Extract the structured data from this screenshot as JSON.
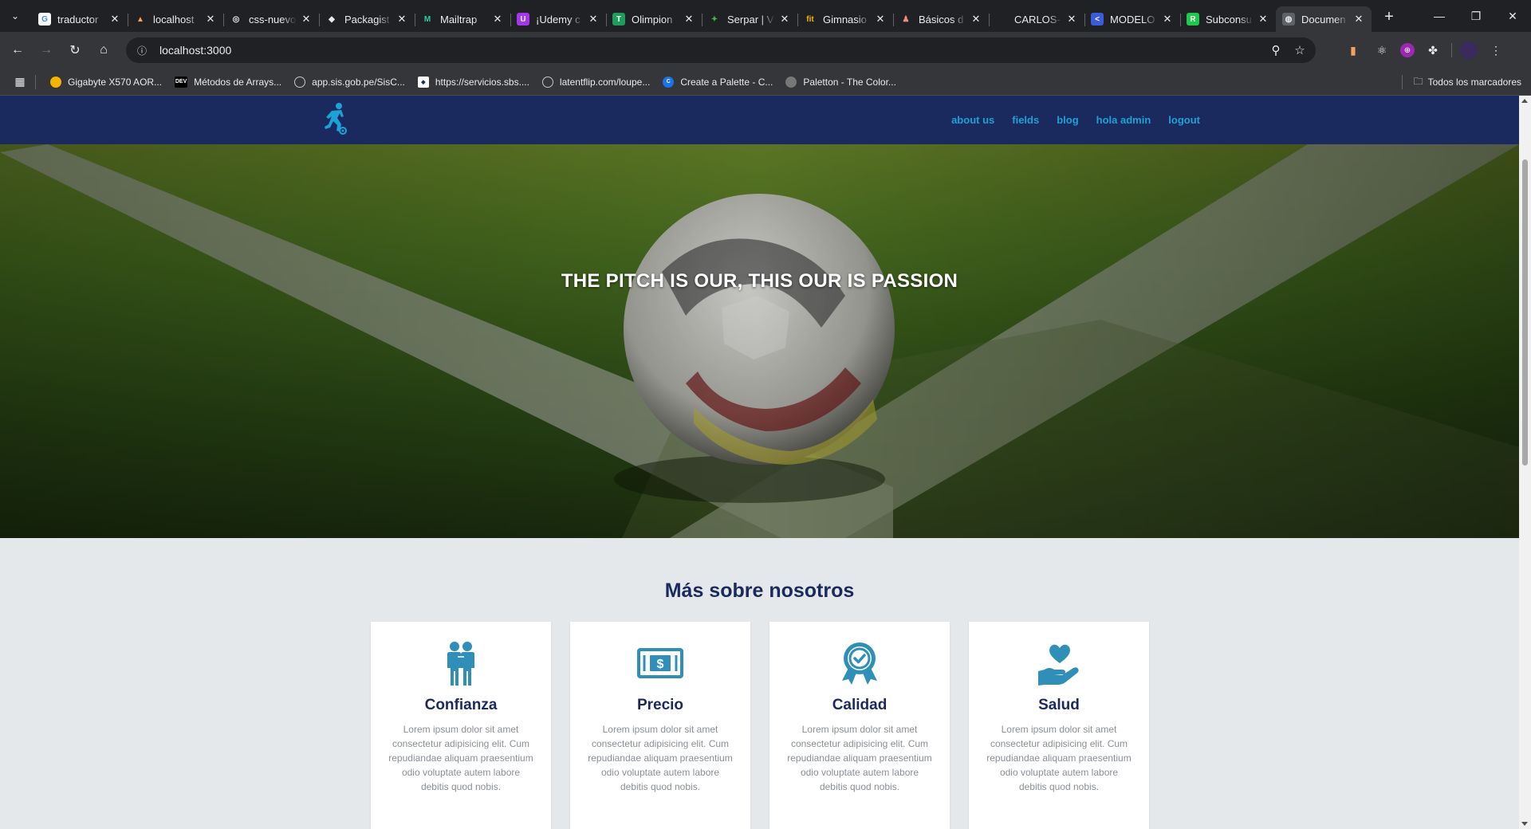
{
  "browser": {
    "tabs": [
      {
        "title": "traductor",
        "fav": "G",
        "fav_color": "#ffffff",
        "fav_text": "#4285f4"
      },
      {
        "title": "localhost",
        "fav": "▲",
        "fav_color": "#202124",
        "fav_text": "#f4a261"
      },
      {
        "title": "css-nuevo",
        "fav": "◎",
        "fav_color": "#202124",
        "fav_text": "#e8eaed"
      },
      {
        "title": "Packagist",
        "fav": "◆",
        "fav_color": "#202124",
        "fav_text": "#e8eaed"
      },
      {
        "title": "Mailtrap",
        "fav": "M",
        "fav_color": "#202124",
        "fav_text": "#22d3a6"
      },
      {
        "title": "¡Udemy c",
        "fav": "U",
        "fav_color": "#a435f0",
        "fav_text": "#ffffff"
      },
      {
        "title": "Olimpion",
        "fav": "T",
        "fav_color": "#1e9e5a",
        "fav_text": "#ffffff"
      },
      {
        "title": "Serpar | V",
        "fav": "✦",
        "fav_color": "#202124",
        "fav_text": "#4caf50"
      },
      {
        "title": "Gimnasio",
        "fav": "fit",
        "fav_color": "#202124",
        "fav_text": "#f4b400"
      },
      {
        "title": "Básicos d",
        "fav": "♟",
        "fav_color": "#202124",
        "fav_text": "#f28b82"
      },
      {
        "title": "CARLOS-",
        "fav": "",
        "fav_color": "#202124",
        "fav_text": "#e8eaed"
      },
      {
        "title": "MODELO",
        "fav": "<",
        "fav_color": "#3b5bdb",
        "fav_text": "#ffffff"
      },
      {
        "title": "Subconsu",
        "fav": "R",
        "fav_color": "#1ec94c",
        "fav_text": "#ffffff"
      },
      {
        "title": "Documen",
        "fav": "◍",
        "fav_color": "#5f6368",
        "fav_text": "#e8eaed",
        "active": true
      }
    ],
    "url": "localhost:3000",
    "bookmarks": [
      {
        "label": "Gigabyte X570 AOR...",
        "fav": "●",
        "color": "#f4b400"
      },
      {
        "label": "Métodos de Arrays...",
        "fav": "DEV",
        "color": "#000000"
      },
      {
        "label": "app.sis.gob.pe/SisC...",
        "fav": "◍",
        "color": "#5f6368"
      },
      {
        "label": "https://servicios.sbs....",
        "fav": "◆",
        "color": "#ffffff"
      },
      {
        "label": "latentflip.com/loupe...",
        "fav": "◍",
        "color": "#5f6368"
      },
      {
        "label": "Create a Palette - C...",
        "fav": "C",
        "color": "#1a73e8"
      },
      {
        "label": "Paletton - The Color...",
        "fav": "◐",
        "color": "#777777"
      }
    ],
    "all_bookmarks": "Todos los marcadores"
  },
  "site": {
    "nav": [
      "about us",
      "fields",
      "blog",
      "hola admin",
      "logout"
    ],
    "hero_title": "THE PITCH IS OUR, THIS OUR IS PASSION",
    "about_title": "Más sobre nosotros",
    "cards": [
      {
        "title": "Confianza",
        "text": "Lorem ipsum dolor sit amet consectetur adipisicing elit. Cum repudiandae aliquam praesentium odio voluptate autem labore debitis quod nobis.",
        "icon": "people-icon"
      },
      {
        "title": "Precio",
        "text": "Lorem ipsum dolor sit amet consectetur adipisicing elit. Cum repudiandae aliquam praesentium odio voluptate autem labore debitis quod nobis.",
        "icon": "money-icon"
      },
      {
        "title": "Calidad",
        "text": "Lorem ipsum dolor sit amet consectetur adipisicing elit. Cum repudiandae aliquam praesentium odio voluptate autem labore debitis quod nobis.",
        "icon": "award-icon"
      },
      {
        "title": "Salud",
        "text": "Lorem ipsum dolor sit amet consectetur adipisicing elit. Cum repudiandae aliquam praesentium odio voluptate autem labore debitis quod nobis.",
        "icon": "heart-hand-icon"
      }
    ],
    "colors": {
      "navy": "#1b2a5e",
      "accent": "#1da1d6",
      "icon": "#2f8fb8",
      "background": "#e5e8eb"
    }
  }
}
